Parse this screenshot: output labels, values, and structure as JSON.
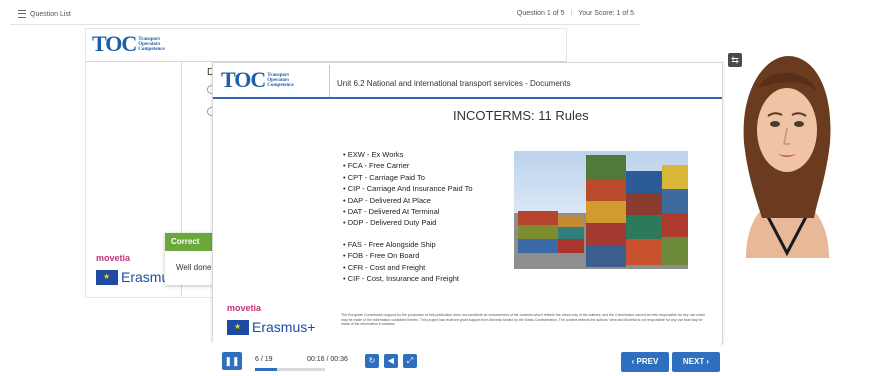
{
  "quiz": {
    "question_list_label": "Question List",
    "question_counter": "Question 1 of 5",
    "score": "Your Score: 1 of 5"
  },
  "back_slide": {
    "logo_main": "TOC",
    "logo_sub": [
      "Transport",
      "Operators",
      "Competence"
    ],
    "question_letter": "D",
    "feedback_title": "Correct",
    "feedback_message": "Well done",
    "movetia": "movetia",
    "erasmus": "Erasmus"
  },
  "slide": {
    "logo_main": "TOC",
    "logo_sub": [
      "Transport",
      "Operators",
      "Competence"
    ],
    "unit_title": "Unit 6.2 National and international transport services - Documents",
    "title": "INCOTERMS: 11 Rules",
    "rules_group1": [
      "• EXW - Ex Works",
      "• FCA - Free Carrier",
      "• CPT - Carriage Paid To",
      "• CIP - Carriage And Insurance Paid To",
      "• DAP - Delivered At Place",
      "• DAT - Delivered At Terminal",
      "• DDP - Delivered Duty Paid"
    ],
    "rules_group2": [
      "• FAS - Free Alongside Ship",
      "• FOB - Free On Board",
      "• CFR - Cost and Freight",
      "• CIF - Cost, Insurance and Freight"
    ],
    "movetia": "movetia",
    "erasmus": "Erasmus+",
    "disclaimer": "The European Commission support for the production of this publication does not constitute an endorsement of the contents which reflects the views only of the authors, and the Commission cannot be held responsible for any use which may be made of the information contained therein. This project has received grant support from Movetia funded by the Swiss Confederation. The content reflects the authors' view and Movetia is not responsible for any use that may be made of the information it contains."
  },
  "player": {
    "slide_counter": "6 / 19",
    "time": "00:16 / 00:36",
    "progress": 0.316,
    "prev_label": "‹ PREV",
    "next_label": "NEXT ›"
  },
  "colors": {
    "accent": "#2f6fc0",
    "correct": "#6aa83a",
    "toc_blue": "#1f5fa8",
    "movetia": "#c0387a"
  },
  "icons": {
    "pause": "pause-icon",
    "replay": "replay-icon",
    "volume": "volume-icon",
    "fullscreen": "fullscreen-icon",
    "expand": "expand-icon",
    "question_list": "list-icon"
  }
}
